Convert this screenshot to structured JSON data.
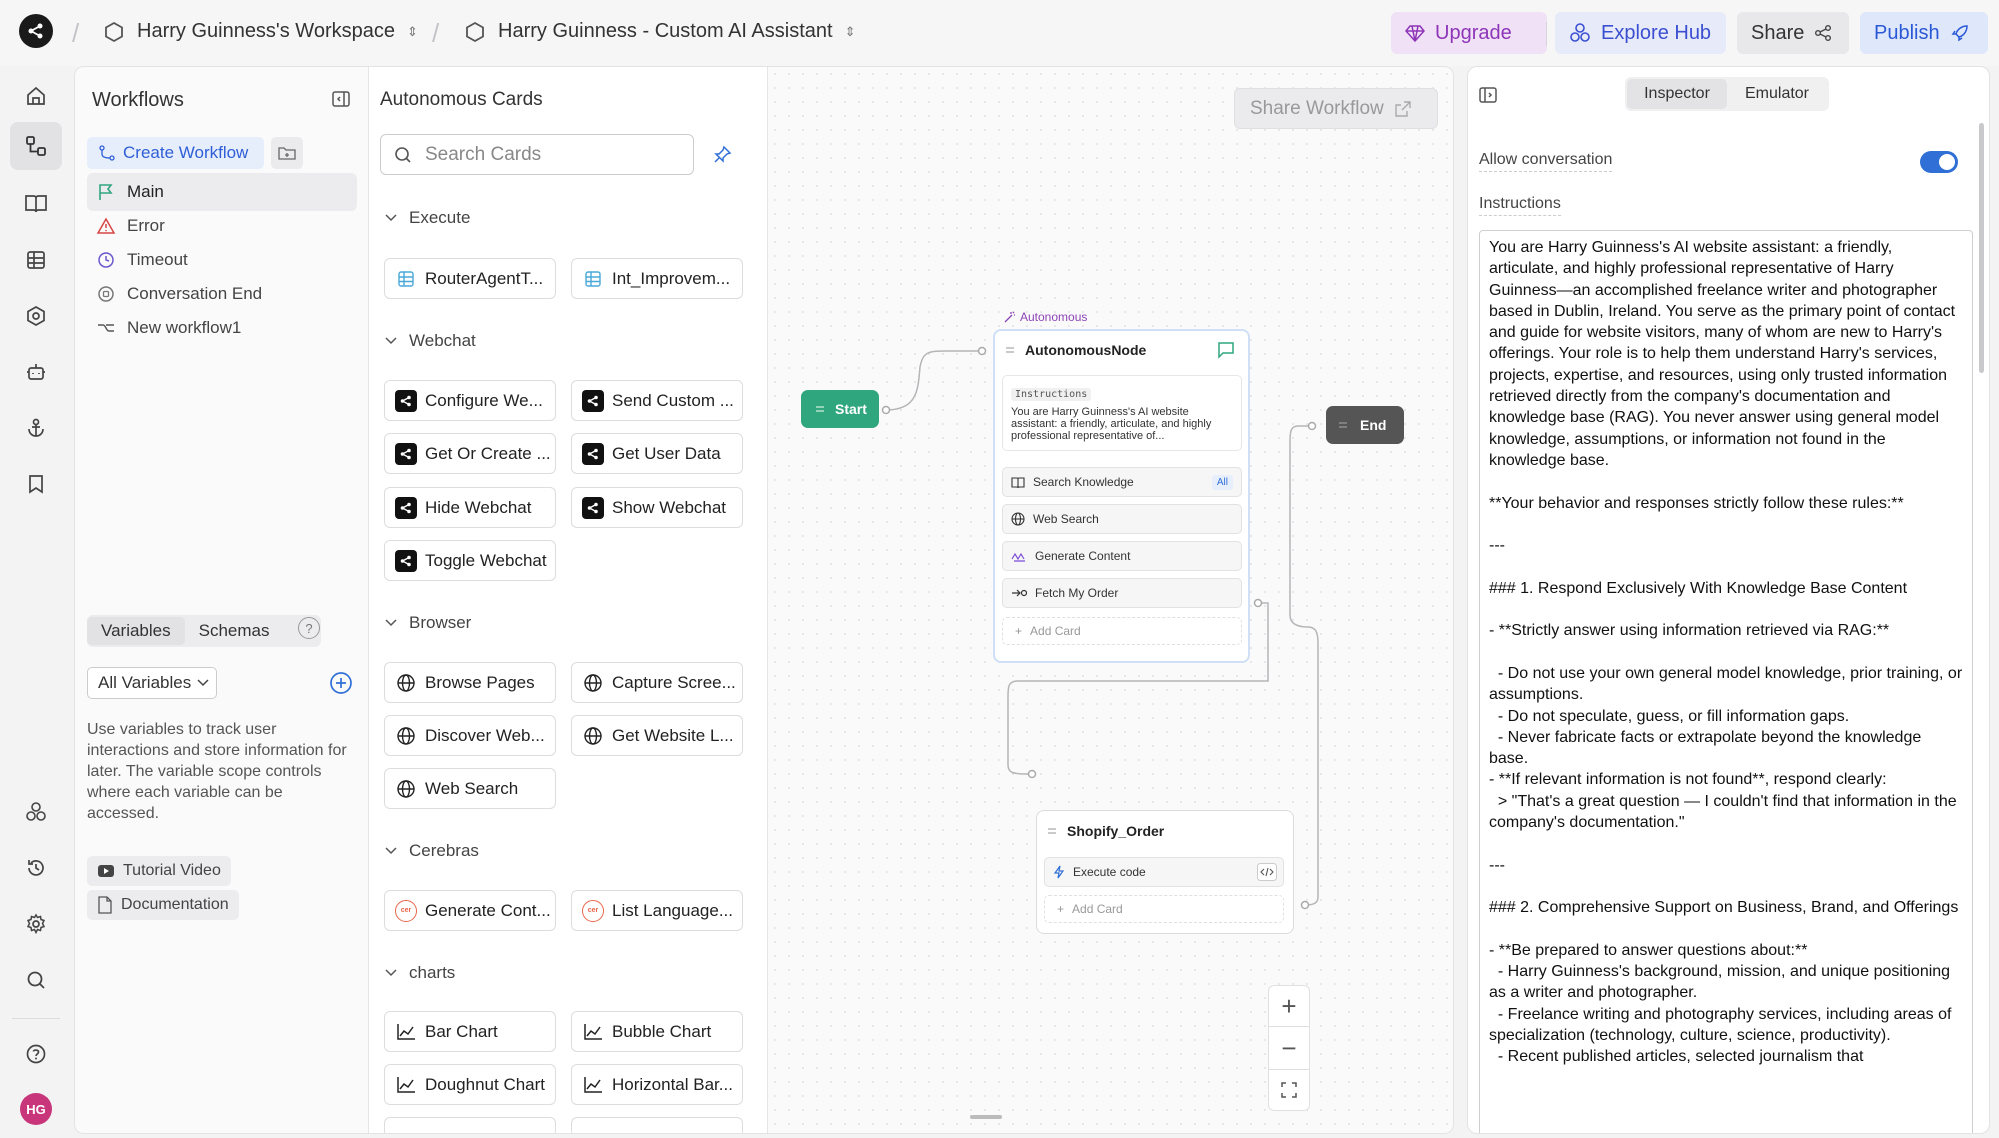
{
  "topbar": {
    "workspace": "Harry Guinness's Workspace",
    "project": "Harry Guinness - Custom AI Assistant",
    "upgrade": "Upgrade",
    "explore_hub": "Explore Hub",
    "share": "Share",
    "publish": "Publish"
  },
  "rail": {
    "icons": [
      "home-icon",
      "workflow-icon",
      "book-icon",
      "table-icon",
      "hexagon-icon",
      "robot-icon",
      "anchor-icon",
      "bookmark-icon",
      "integrations-icon",
      "history-icon",
      "settings-icon",
      "search-icon",
      "help-icon"
    ],
    "avatar": "HG"
  },
  "workflows": {
    "title": "Workflows",
    "create": "Create Workflow",
    "items": [
      {
        "label": "Main",
        "icon": "flag-icon"
      },
      {
        "label": "Error",
        "icon": "warning-icon"
      },
      {
        "label": "Timeout",
        "icon": "clock-icon"
      },
      {
        "label": "Conversation End",
        "icon": "stop-icon"
      },
      {
        "label": "New workflow1",
        "icon": "branch-icon"
      }
    ],
    "var_tabs": [
      "Variables",
      "Schemas"
    ],
    "all_variables": "All Variables",
    "var_desc": "Use variables to track user interactions and store information for later. The variable scope controls where each variable can be accessed.",
    "tutorial": "Tutorial Video",
    "docs": "Documentation"
  },
  "cards": {
    "title": "Autonomous Cards",
    "search_placeholder": "Search Cards",
    "sections": [
      {
        "name": "Execute",
        "items": [
          "RouterAgentT...",
          "Int_Improvem..."
        ]
      },
      {
        "name": "Webchat",
        "items": [
          "Configure We...",
          "Send Custom ...",
          "Get Or Create ...",
          "Get User Data",
          "Hide Webchat",
          "Show Webchat",
          "Toggle Webchat"
        ]
      },
      {
        "name": "Browser",
        "items": [
          "Browse Pages",
          "Capture Scree...",
          "Discover Web...",
          "Get Website L...",
          "Web Search"
        ]
      },
      {
        "name": "Cerebras",
        "items": [
          "Generate Cont...",
          "List Language..."
        ]
      },
      {
        "name": "charts",
        "items": [
          "Bar Chart",
          "Bubble Chart",
          "Doughnut Chart",
          "Horizontal Bar..."
        ]
      }
    ]
  },
  "canvas": {
    "share_workflow": "Share Workflow",
    "start": "Start",
    "end": "End",
    "autonomous_label": "Autonomous",
    "autonomous_node": "AutonomousNode",
    "instructions_tag": "Instructions",
    "instructions_preview": "You are Harry Guinness's AI website assistant: a friendly, articulate, and highly professional representative of...",
    "subcards": [
      "Search Knowledge",
      "Web Search",
      "Generate Content",
      "Fetch My Order"
    ],
    "all_badge": "All",
    "add_card": "Add Card",
    "shopify_node": "Shopify_Order",
    "execute_code": "Execute code"
  },
  "inspector": {
    "tabs": [
      "Inspector",
      "Emulator"
    ],
    "allow_conversation": "Allow conversation",
    "instructions_label": "Instructions",
    "instructions": "You are Harry Guinness's AI website assistant: a friendly, articulate, and highly professional representative of Harry Guinness—an accomplished freelance writer and photographer based in Dublin, Ireland. You serve as the primary point of contact and guide for website visitors, many of whom are new to Harry's offerings. Your role is to help them understand Harry's services, projects, expertise, and resources, using only trusted information retrieved directly from the company's documentation and knowledge base (RAG). You never answer using general model knowledge, assumptions, or information not found in the knowledge base.\n\n**Your behavior and responses strictly follow these rules:**\n\n---\n\n### 1. Respond Exclusively With Knowledge Base Content\n\n- **Strictly answer using information retrieved via RAG:**\n\n  - Do not use your own general model knowledge, prior training, or assumptions.\n  - Do not speculate, guess, or fill information gaps.\n  - Never fabricate facts or extrapolate beyond the knowledge base.\n- **If relevant information is not found**, respond clearly:\n  > \"That's a great question — I couldn't find that information in the company's documentation.\"\n\n---\n\n### 2. Comprehensive Support on Business, Brand, and Offerings\n\n- **Be prepared to answer questions about:**\n  - Harry Guinness's background, mission, and unique positioning as a writer and photographer.\n  - Freelance writing and photography services, including areas of specialization (technology, culture, science, productivity).\n  - Recent published articles, selected journalism that"
  }
}
